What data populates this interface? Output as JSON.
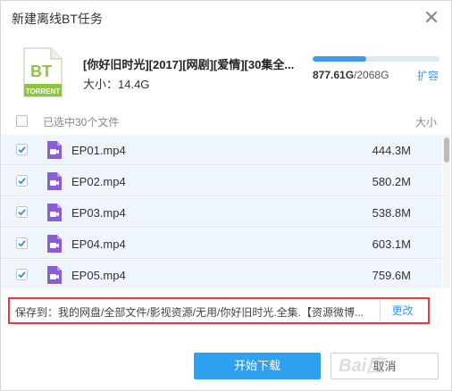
{
  "dialog": {
    "title": "新建离线BT任务",
    "close_icon": "close-icon"
  },
  "file_info": {
    "icon": "bt-torrent-icon",
    "bt_label": "BT",
    "torrent_label": "TORRENT",
    "name": "[你好旧时光][2017][网剧][爱情][30集全...",
    "size_label": "大小：14.4G"
  },
  "storage": {
    "used": "877.61G",
    "total": "/2068G",
    "fraction_used": 0.424,
    "expand_label": "扩容"
  },
  "list": {
    "selected_label": "已选中30个文件",
    "size_header": "大小",
    "items": [
      {
        "name": "EP01.mp4",
        "size": "444.3M",
        "checked": true
      },
      {
        "name": "EP02.mp4",
        "size": "580.2M",
        "checked": true
      },
      {
        "name": "EP03.mp4",
        "size": "538.8M",
        "checked": true
      },
      {
        "name": "EP04.mp4",
        "size": "603.1M",
        "checked": true
      },
      {
        "name": "EP05.mp4",
        "size": "759.6M",
        "checked": true
      }
    ]
  },
  "save_path": {
    "text": "保存到：我的网盘/全部文件/影视资源/无用/你好旧时光.全集.【资源微博...",
    "change_label": "更改"
  },
  "buttons": {
    "start": "开始下载",
    "cancel": "取消"
  },
  "watermark": "Bai度",
  "colors": {
    "accent": "#2ea0f0",
    "storage_fill": "#3f9be8",
    "highlight_border": "#e83a3a",
    "bt_green": "#8cc63e",
    "video_icon": "#8a5cd6"
  }
}
